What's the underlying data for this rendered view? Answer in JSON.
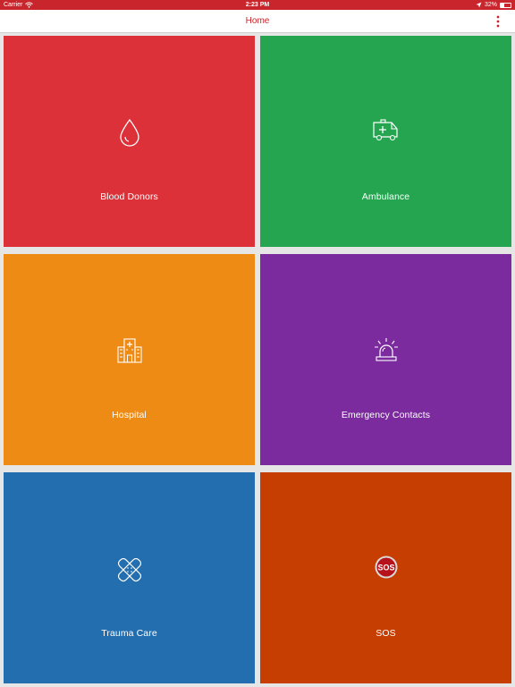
{
  "status_bar": {
    "carrier": "Carrier",
    "time": "2:23 PM",
    "battery": "32%",
    "battery_level": 0.32
  },
  "nav": {
    "title": "Home"
  },
  "tiles": [
    {
      "label": "Blood Donors",
      "icon": "blood-drop-icon",
      "color": "#dc3138"
    },
    {
      "label": "Ambulance",
      "icon": "ambulance-icon",
      "color": "#26a551"
    },
    {
      "label": "Hospital",
      "icon": "hospital-icon",
      "color": "#ee8b14"
    },
    {
      "label": "Emergency Contacts",
      "icon": "siren-icon",
      "color": "#7b2b9e"
    },
    {
      "label": "Trauma Care",
      "icon": "bandage-icon",
      "color": "#226eaf"
    },
    {
      "label": "SOS",
      "icon": "sos-icon",
      "color": "#c73e02"
    }
  ],
  "sos_badge": "SOS"
}
